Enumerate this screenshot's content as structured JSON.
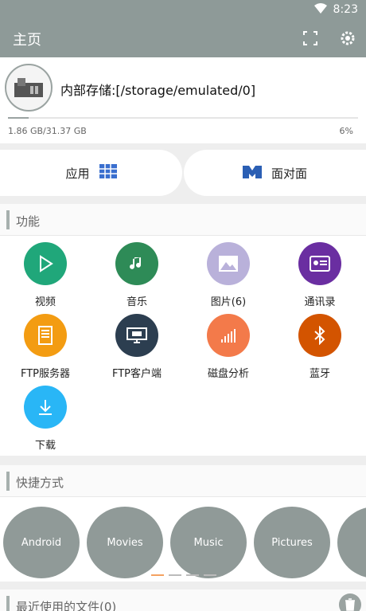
{
  "status_bar": {
    "time": "8:23"
  },
  "app_bar": {
    "title": "主页"
  },
  "storage": {
    "path": "内部存储:[/storage/emulated/0]",
    "used": "1.86 GB/31.37 GB",
    "percent_text": "6%",
    "used_fraction": 0.06
  },
  "quick_pills": {
    "apps_label": "应用",
    "face_label": "面对面"
  },
  "functions": {
    "header": "功能",
    "items": [
      {
        "label": "视频",
        "icon": "play-icon",
        "color": "#20a77a"
      },
      {
        "label": "音乐",
        "icon": "music-note-icon",
        "color": "#2e8b57"
      },
      {
        "label": "图片(6)",
        "icon": "image-icon",
        "color": "#b9b1da"
      },
      {
        "label": "通讯录",
        "icon": "contacts-icon",
        "color": "#6a2ea1"
      },
      {
        "label": "FTP服务器",
        "icon": "ftp-server-icon",
        "color": "#f39c12"
      },
      {
        "label": "FTP客户端",
        "icon": "ftp-client-icon",
        "color": "#2c3e50"
      },
      {
        "label": "磁盘分析",
        "icon": "disk-analysis-icon",
        "color": "#f37a4a"
      },
      {
        "label": "蓝牙",
        "icon": "bluetooth-icon",
        "color": "#d35400"
      },
      {
        "label": "下载",
        "icon": "download-icon",
        "color": "#29b6f6"
      }
    ]
  },
  "shortcuts": {
    "header": "快捷方式",
    "items": [
      "Android",
      "Movies",
      "Music",
      "Pictures"
    ]
  },
  "recent": {
    "header": "最近使用的文件(0)"
  }
}
